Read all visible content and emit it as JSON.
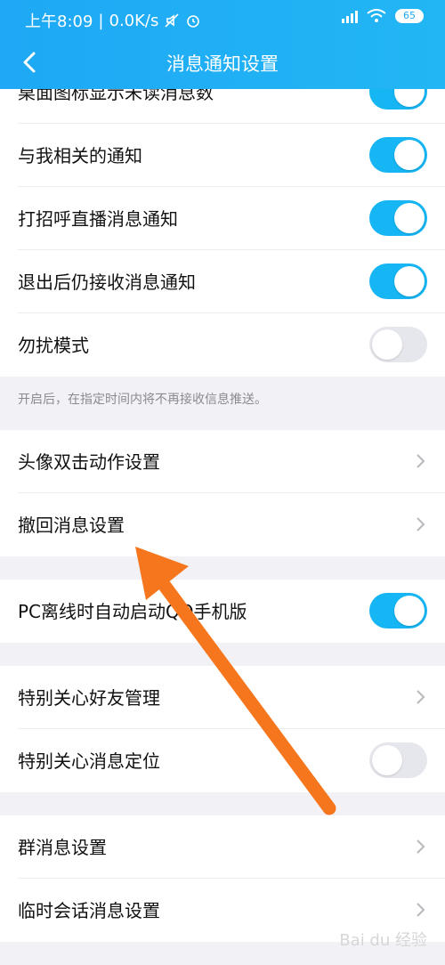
{
  "status_bar": {
    "time": "上午8:09",
    "speed": "0.0K/s",
    "battery": "65"
  },
  "header": {
    "title": "消息通知设置"
  },
  "settings": {
    "desktop_badge": {
      "label": "桌面图标显示未读消息数",
      "on": true
    },
    "related_notice": {
      "label": "与我相关的通知",
      "on": true
    },
    "greet_live": {
      "label": "打招呼直播消息通知",
      "on": true
    },
    "after_logout": {
      "label": "退出后仍接收消息通知",
      "on": true
    },
    "dnd_mode": {
      "label": "勿扰模式",
      "on": false
    },
    "dnd_hint": "开启后，在指定时间内将不再接收信息推送。",
    "avatar_double_tap": {
      "label": "头像双击动作设置"
    },
    "recall_message": {
      "label": "撤回消息设置"
    },
    "pc_offline": {
      "label": "PC离线时自动启动QQ手机版",
      "on": true
    },
    "special_care_friends": {
      "label": "特别关心好友管理"
    },
    "special_care_locate": {
      "label": "特别关心消息定位",
      "on": false
    },
    "group_message": {
      "label": "群消息设置"
    },
    "temp_chat": {
      "label": "临时会话消息设置"
    }
  },
  "watermark": "Bai du 经验",
  "colors": {
    "header_bg": "#1ea8f5",
    "switch_on": "#16b5f3",
    "switch_off": "#e6e7ec",
    "arrow": "#f6761d"
  }
}
